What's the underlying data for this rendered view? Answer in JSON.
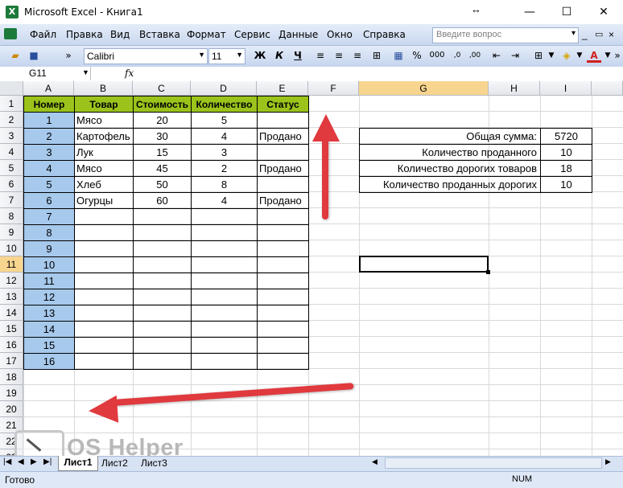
{
  "window": {
    "app_icon": "X",
    "title": "Microsoft Excel - Книга1",
    "controls": {
      "resize": "↔",
      "minimize": "—",
      "maximize": "☐",
      "close": "✕"
    }
  },
  "menu": {
    "items": [
      "Файл",
      "Правка",
      "Вид",
      "Вставка",
      "Формат",
      "Сервис",
      "Данные",
      "Окно",
      "Справка"
    ],
    "ask_placeholder": "Введите вопрос"
  },
  "toolbar": {
    "font_name": "Calibri",
    "font_size": "11",
    "bold": "Ж",
    "italic": "К",
    "underline": "Ч",
    "percent": "%",
    "thousands": "000",
    "font_color_letter": "A"
  },
  "formula_bar": {
    "name_box": "G11",
    "fx": "fx",
    "content": ""
  },
  "columns": [
    "A",
    "B",
    "C",
    "D",
    "E",
    "F",
    "G",
    "H",
    "I"
  ],
  "rows": [
    "1",
    "2",
    "3",
    "4",
    "5",
    "6",
    "7",
    "8",
    "9",
    "10",
    "11",
    "12",
    "13",
    "14",
    "15",
    "16",
    "17",
    "18",
    "19",
    "20",
    "21",
    "22",
    "23"
  ],
  "selected_cell": "G11",
  "table": {
    "headers": [
      "Номер",
      "Товар",
      "Стоимость",
      "Количество",
      "Статус"
    ],
    "rows": [
      [
        "1",
        "Мясо",
        "20",
        "5",
        ""
      ],
      [
        "2",
        "Картофель",
        "30",
        "4",
        "Продано"
      ],
      [
        "3",
        "Лук",
        "15",
        "3",
        ""
      ],
      [
        "4",
        "Мясо",
        "45",
        "2",
        "Продано"
      ],
      [
        "5",
        "Хлеб",
        "50",
        "8",
        ""
      ],
      [
        "6",
        "Огурцы",
        "60",
        "4",
        "Продано"
      ],
      [
        "7",
        "",
        "",
        "",
        ""
      ],
      [
        "8",
        "",
        "",
        "",
        ""
      ],
      [
        "9",
        "",
        "",
        "",
        ""
      ],
      [
        "10",
        "",
        "",
        "",
        ""
      ],
      [
        "11",
        "",
        "",
        "",
        ""
      ],
      [
        "12",
        "",
        "",
        "",
        ""
      ],
      [
        "13",
        "",
        "",
        "",
        ""
      ],
      [
        "14",
        "",
        "",
        "",
        ""
      ],
      [
        "15",
        "",
        "",
        "",
        ""
      ],
      [
        "16",
        "",
        "",
        "",
        ""
      ]
    ]
  },
  "summary": [
    {
      "label": "Общая сумма:",
      "value": "5720"
    },
    {
      "label": "Количество проданного",
      "value": "10"
    },
    {
      "label": "Количество дорогих товаров",
      "value": "18"
    },
    {
      "label": "Количество проданных дорогих",
      "value": "10"
    }
  ],
  "sheets": {
    "tabs": [
      "Лист1",
      "Лист2",
      "Лист3"
    ],
    "active": "Лист1"
  },
  "status": {
    "ready": "Готово",
    "num": "NUM"
  },
  "watermark": "OS Helper",
  "colors": {
    "header_green": "#9bc31b",
    "number_blue": "#a6c9ec",
    "arrow_red": "#e0393e",
    "selected_header": "#f8d58f"
  }
}
